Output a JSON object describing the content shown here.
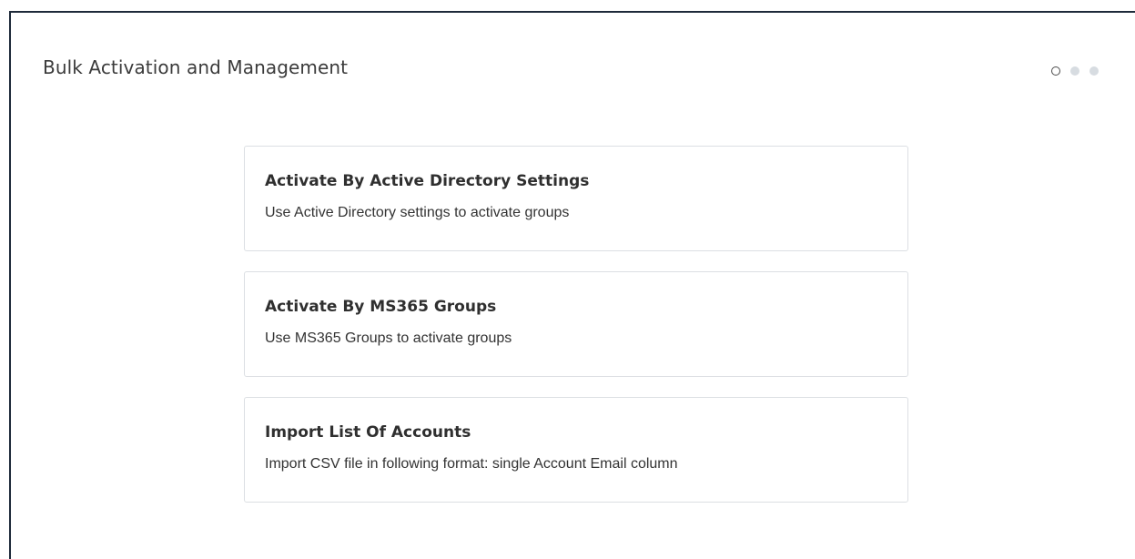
{
  "dialog": {
    "title": "Bulk Activation and Management"
  },
  "steps": {
    "total": 3,
    "current": 1
  },
  "options": [
    {
      "title": "Activate By Active Directory Settings",
      "description": "Use Active Directory settings to activate groups"
    },
    {
      "title": "Activate By MS365 Groups",
      "description": "Use MS365 Groups to activate groups"
    },
    {
      "title": "Import List Of Accounts",
      "description": "Import CSV file in following format: single Account Email column"
    }
  ]
}
